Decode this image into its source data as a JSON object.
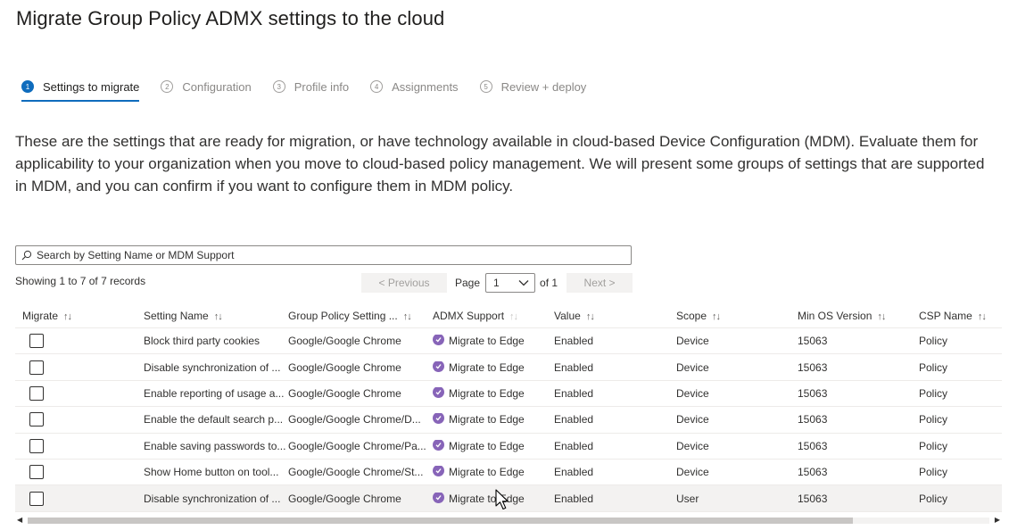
{
  "page": {
    "title": "Migrate Group Policy ADMX settings to the cloud",
    "description": "These are the settings that are ready for migration, or have technology available in cloud-based Device Configuration (MDM). Evaluate them for applicability to your organization when you move to cloud-based policy management. We will present some groups of settings that are supported in MDM, and you can confirm if you want to configure them in MDM policy."
  },
  "steps": [
    {
      "num": "1",
      "label": "Settings to migrate",
      "active": true
    },
    {
      "num": "2",
      "label": "Configuration",
      "active": false
    },
    {
      "num": "3",
      "label": "Profile info",
      "active": false
    },
    {
      "num": "4",
      "label": "Assignments",
      "active": false
    },
    {
      "num": "5",
      "label": "Review + deploy",
      "active": false
    }
  ],
  "search": {
    "placeholder": "Search by Setting Name or MDM Support",
    "icon": "search-icon"
  },
  "records_text": "Showing 1 to 7 of 7 records",
  "pager": {
    "previous": "< Previous",
    "page_label": "Page",
    "page_value": "1",
    "of_label": "of 1",
    "next": "Next >"
  },
  "table": {
    "columns": [
      {
        "label": "Migrate",
        "sort": "↑↓"
      },
      {
        "label": "Setting Name",
        "sort": "↑↓"
      },
      {
        "label": "Group Policy Setting ...",
        "sort": "↑↓"
      },
      {
        "label": "ADMX Support",
        "sort": "↑↓"
      },
      {
        "label": "Value",
        "sort": "↑↓"
      },
      {
        "label": "Scope",
        "sort": "↑↓"
      },
      {
        "label": "Min OS Version",
        "sort": "↑↓"
      },
      {
        "label": "CSP Name",
        "sort": "↑↓"
      }
    ],
    "rows": [
      {
        "setting": "Block third party cookies",
        "gp": "Google/Google Chrome",
        "support": "Migrate to Edge",
        "value": "Enabled",
        "scope": "Device",
        "os": "15063",
        "csp": "Policy"
      },
      {
        "setting": "Disable synchronization of ...",
        "gp": "Google/Google Chrome",
        "support": "Migrate to Edge",
        "value": "Enabled",
        "scope": "Device",
        "os": "15063",
        "csp": "Policy"
      },
      {
        "setting": "Enable reporting of usage a...",
        "gp": "Google/Google Chrome",
        "support": "Migrate to Edge",
        "value": "Enabled",
        "scope": "Device",
        "os": "15063",
        "csp": "Policy"
      },
      {
        "setting": "Enable the default search p...",
        "gp": "Google/Google Chrome/D...",
        "support": "Migrate to Edge",
        "value": "Enabled",
        "scope": "Device",
        "os": "15063",
        "csp": "Policy"
      },
      {
        "setting": "Enable saving passwords to...",
        "gp": "Google/Google Chrome/Pa...",
        "support": "Migrate to Edge",
        "value": "Enabled",
        "scope": "Device",
        "os": "15063",
        "csp": "Policy"
      },
      {
        "setting": "Show Home button on tool...",
        "gp": "Google/Google Chrome/St...",
        "support": "Migrate to Edge",
        "value": "Enabled",
        "scope": "Device",
        "os": "15063",
        "csp": "Policy"
      },
      {
        "setting": "Disable synchronization of ...",
        "gp": "Google/Google Chrome",
        "support": "Migrate to Edge",
        "value": "Enabled",
        "scope": "User",
        "os": "15063",
        "csp": "Policy"
      }
    ]
  },
  "colors": {
    "accent": "#0f6cbd",
    "support_badge": "#8764b8"
  }
}
